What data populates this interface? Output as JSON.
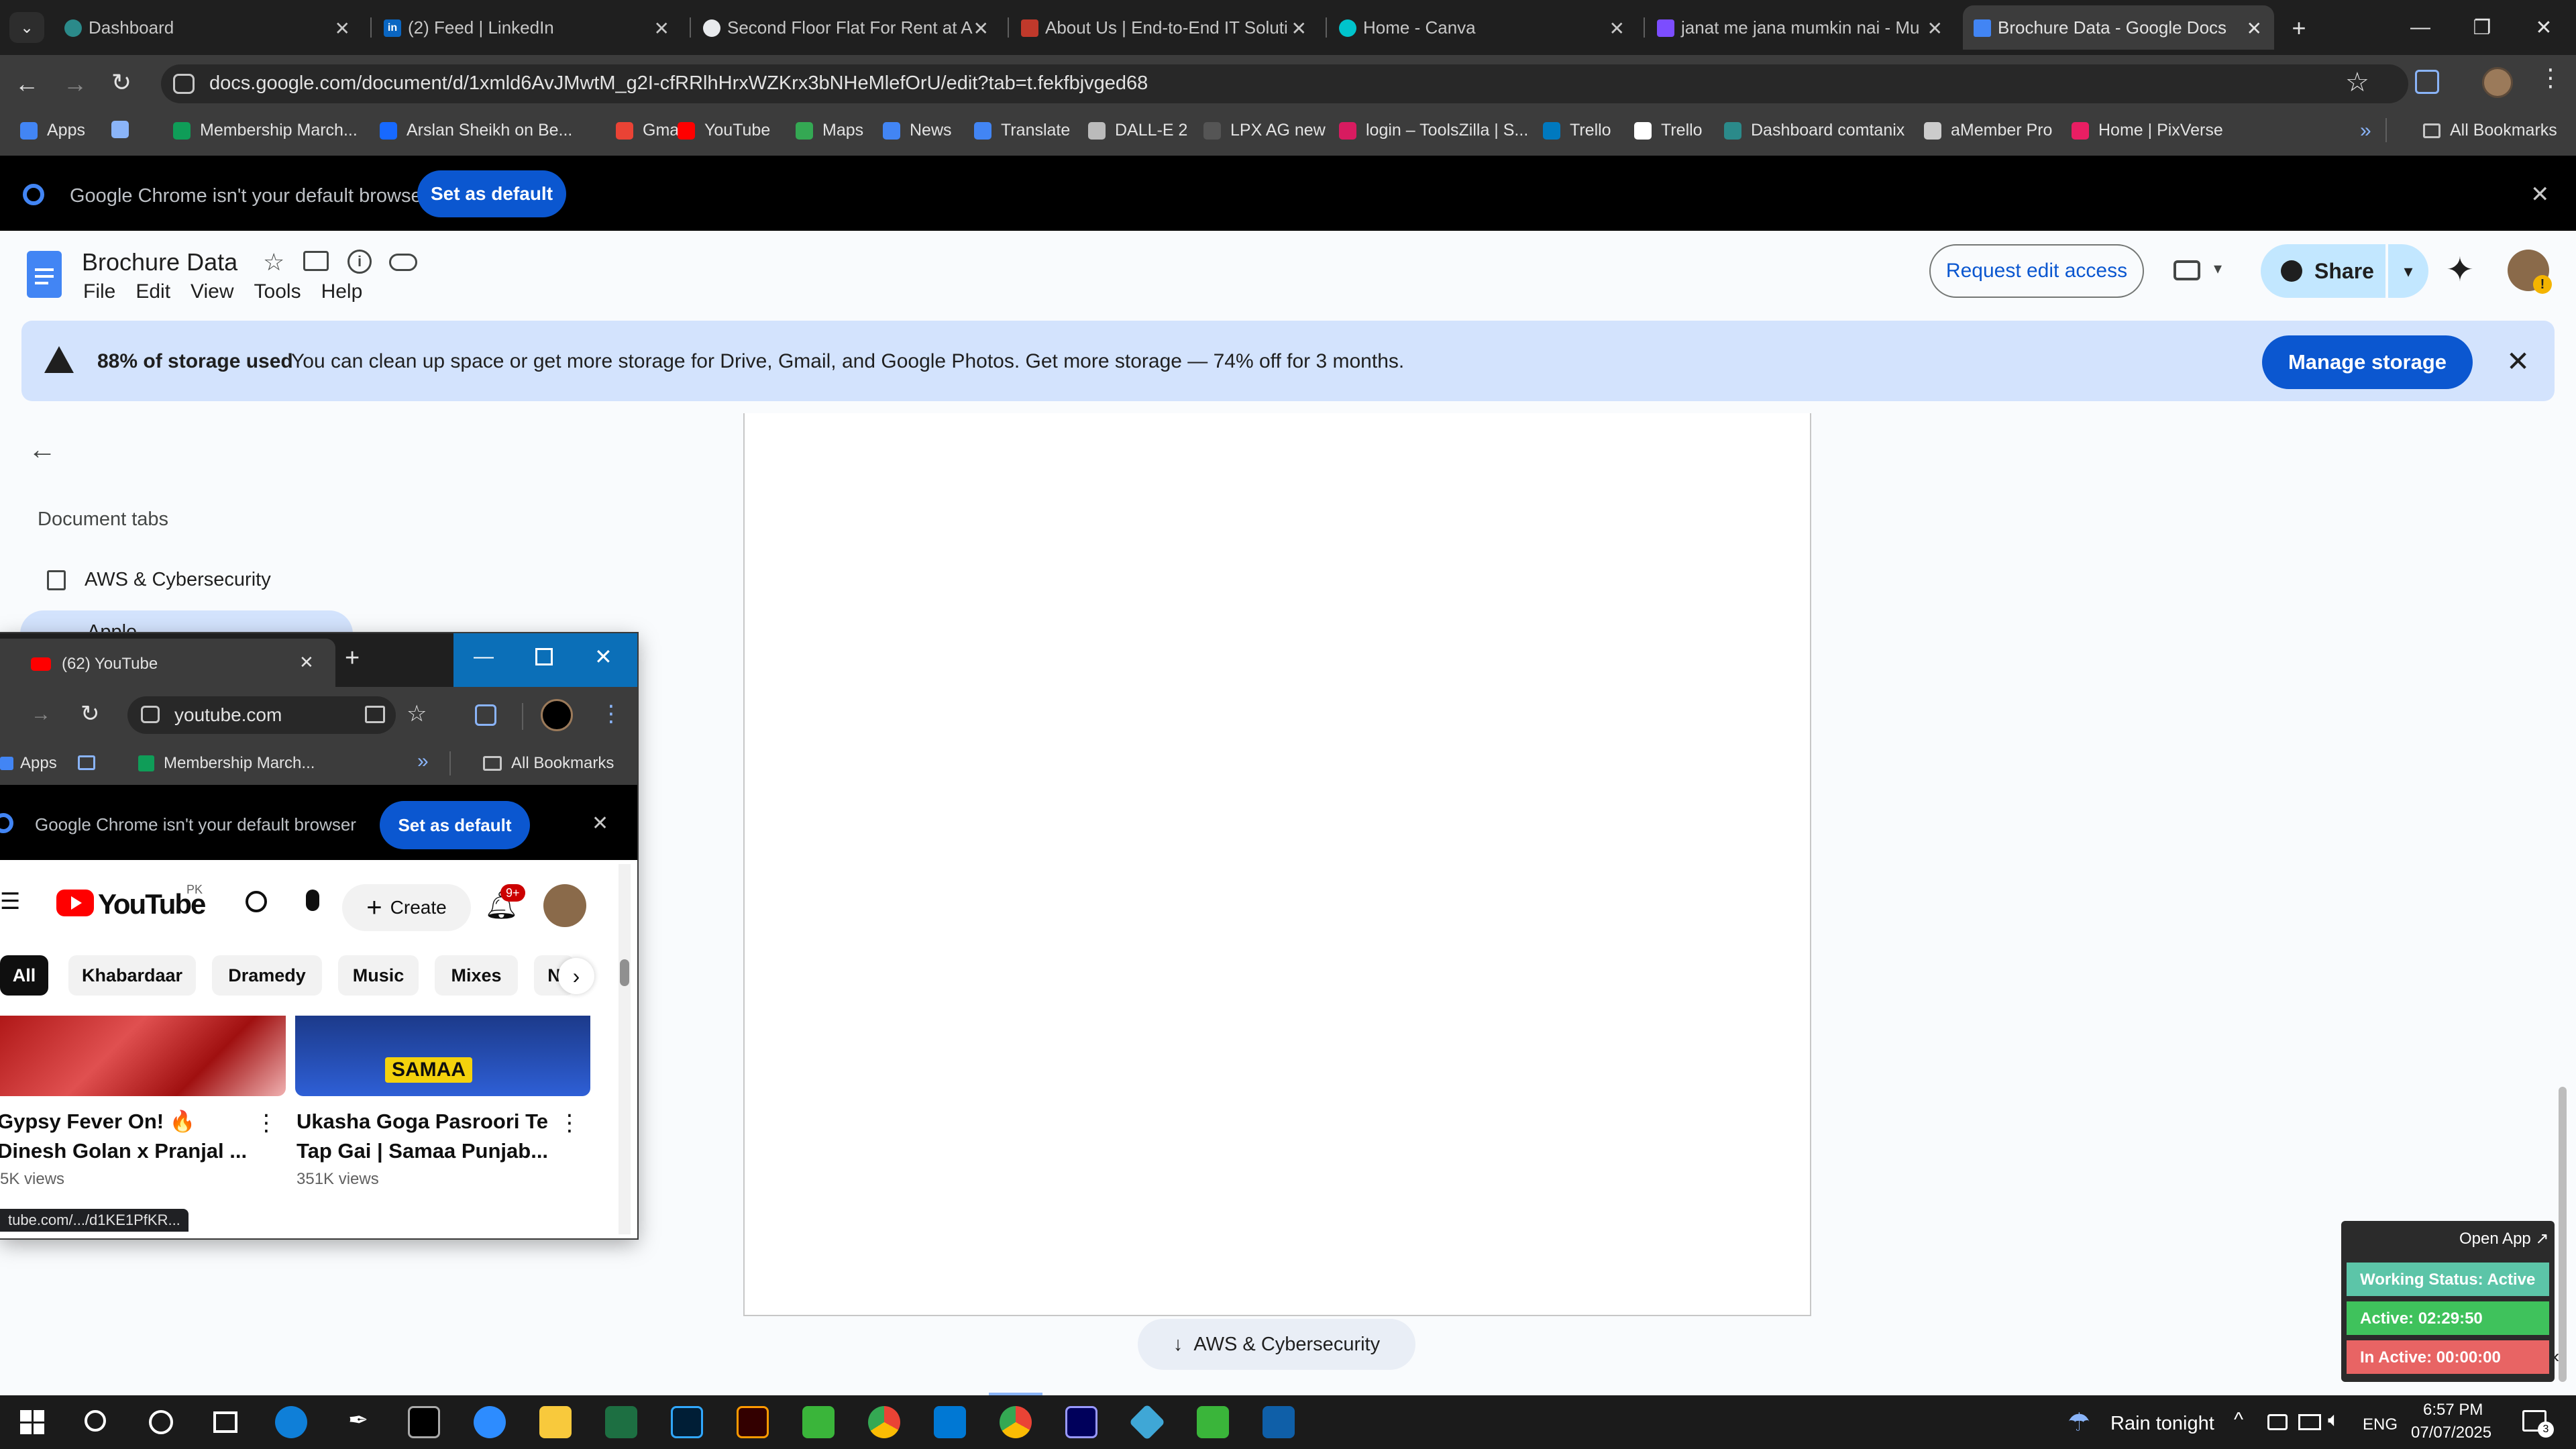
{
  "browser": {
    "tabs": [
      {
        "title": "Dashboard",
        "color": "#2b8a8a"
      },
      {
        "title": "(2) Feed | LinkedIn",
        "color": "#0a66c2"
      },
      {
        "title": "Second Floor Flat For Rent at A",
        "color": "#4285f4"
      },
      {
        "title": "About Us | End-to-End IT Soluti",
        "color": "#c0392b"
      },
      {
        "title": "Home - Canva",
        "color": "#00c4cc"
      },
      {
        "title": "janat me jana mumkin nai - Mu",
        "color": "#7c4dff"
      },
      {
        "title": "Brochure Data - Google Docs",
        "color": "#4285f4"
      }
    ],
    "url": "docs.google.com/document/d/1xmld6AvJMwtM_g2I-cfRRlhHrxWZKrx3bNHeMlefOrU/edit?tab=t.fekfbjvged68",
    "bookmarks": [
      {
        "label": "Apps",
        "icon": "apps-grid-icon",
        "color": "#4285f4"
      },
      {
        "label": "",
        "icon": "tab-groups-icon",
        "color": "#8ab4f8"
      },
      {
        "label": "Membership March...",
        "icon": "sheets-icon",
        "color": "#0f9d58"
      },
      {
        "label": "Arslan Sheikh on Be...",
        "icon": "behance-icon",
        "color": "#1769ff"
      },
      {
        "label": "Gmail",
        "icon": "gmail-icon",
        "color": "#ea4335"
      },
      {
        "label": "YouTube",
        "icon": "youtube-icon",
        "color": "#ff0000"
      },
      {
        "label": "Maps",
        "icon": "maps-icon",
        "color": "#34a853"
      },
      {
        "label": "News",
        "icon": "news-icon",
        "color": "#4285f4"
      },
      {
        "label": "Translate",
        "icon": "translate-icon",
        "color": "#4285f4"
      },
      {
        "label": "DALL-E 2",
        "icon": "openai-icon",
        "color": "#bbbbbb"
      },
      {
        "label": "LPX AG new",
        "icon": "lpx-icon",
        "color": "#555555"
      },
      {
        "label": "login – ToolsZilla | S...",
        "icon": "toolszilla-icon",
        "color": "#d81b60"
      },
      {
        "label": "Trello",
        "icon": "trello-icon",
        "color": "#0079bf"
      },
      {
        "label": "Trello",
        "icon": "trello-icon",
        "color": "#ffffff"
      },
      {
        "label": "Dashboard comtanix",
        "icon": "comtanix-icon",
        "color": "#2b8a8a"
      },
      {
        "label": "aMember Pro",
        "icon": "amember-icon",
        "color": "#cccccc"
      },
      {
        "label": "Home | PixVerse",
        "icon": "pixverse-icon",
        "color": "#e91e63"
      }
    ],
    "all_bookmarks": "All Bookmarks",
    "infobar_text": "Google Chrome isn't your default browser",
    "set_default": "Set as default"
  },
  "docs": {
    "title": "Brochure Data",
    "menu": [
      "File",
      "Edit",
      "View",
      "Tools",
      "Help"
    ],
    "request_edit": "Request edit access",
    "share": "Share",
    "storage_bold": "88% of storage used",
    "storage_text": "You can clean up space or get more storage for Drive, Gmail, and Google Photos. Get more storage — 74% off for 3 months.",
    "manage_storage": "Manage storage",
    "document_tabs_heading": "Document tabs",
    "tabs": [
      "AWS & Cybersecurity",
      "Apple"
    ],
    "bottom_tab_chip": "AWS & Cybersecurity",
    "accent": "#0b57d0"
  },
  "youtube_window": {
    "tab_title": "(62) YouTube",
    "url": "youtube.com",
    "bookmark_apps": "Apps",
    "bookmark_membership": "Membership March...",
    "all_bookmarks": "All Bookmarks",
    "infobar_text": "Google Chrome isn't your default browser",
    "set_default": "Set as default",
    "logo_country": "PK",
    "create": "Create",
    "notifications": "9+",
    "chips": [
      "All",
      "Khabardaar",
      "Dramedy",
      "Music",
      "Mixes",
      "N"
    ],
    "videos": [
      {
        "title_line1": "Gypsy Fever On! 🔥",
        "title_line2": "Dinesh Golan x Pranjal ...",
        "views": "5K views"
      },
      {
        "title_line1": "Ukasha Goga Pasroori Te",
        "title_line2": "Tap Gai | Samaa Punjab...",
        "views": "351K views",
        "thumb_text": "SAMAA"
      }
    ],
    "status_url": "tube.com/.../d1KE1PfKR..."
  },
  "tracker": {
    "open_app": "Open App ↗",
    "working_status": "Working Status: Active",
    "active": "Active: 02:29:50",
    "inactive": "In Active: 00:00:00"
  },
  "taskbar": {
    "weather": "Rain tonight",
    "lang": "ENG",
    "time": "6:57 PM",
    "date": "07/07/2025",
    "notifications": "3"
  }
}
